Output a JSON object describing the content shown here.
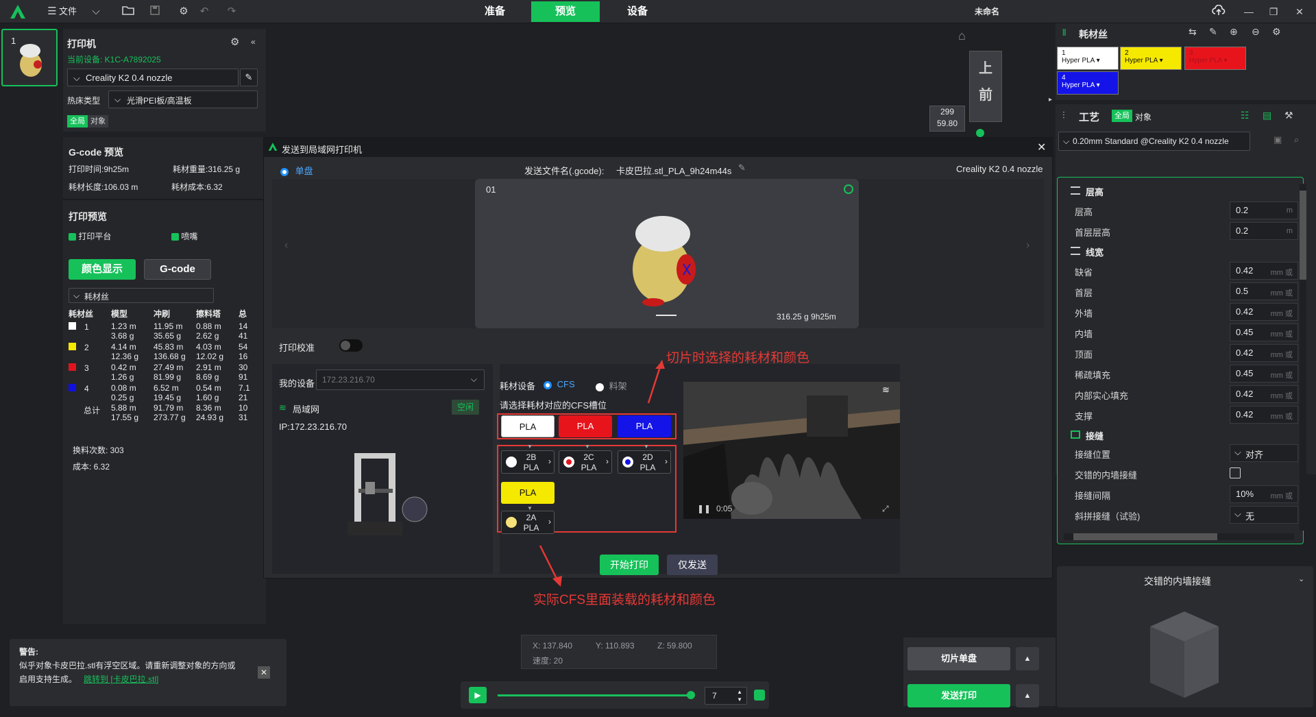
{
  "topbar": {
    "menu_file": "文件",
    "tabs": [
      "准备",
      "预览",
      "设备"
    ],
    "active_tab": "预览",
    "project_name": "未命名"
  },
  "thumb": {
    "index": "1"
  },
  "printer": {
    "title": "打印机",
    "current_device": "当前设备: K1C-A7892025",
    "model": "Creality K2 0.4 nozzle",
    "bed_label": "热床类型",
    "bed_value": "光滑PEI板/高温板",
    "scope_global": "全局",
    "scope_object": "对象"
  },
  "gcode_preview": {
    "title": "G-code 预览",
    "print_time": "打印时间:9h25m",
    "filament_weight": "耗材重量:316.25 g",
    "filament_length": "耗材长度:106.03 m",
    "filament_cost": "耗材成本:6.32"
  },
  "print_preview": {
    "title": "打印预览",
    "platform": "打印平台",
    "nozzle": "喷嘴",
    "btn_color": "颜色显示",
    "btn_gcode": "G-code",
    "dropdown": "耗材丝"
  },
  "filament_table": {
    "headers": [
      "耗材丝",
      "模型",
      "冲刷",
      "擦料塔",
      "总"
    ],
    "rows": [
      {
        "id": "1",
        "color": "#ffffff",
        "model": [
          "1.23 m",
          "3.68 g"
        ],
        "flush": [
          "11.95 m",
          "35.65 g"
        ],
        "tower": [
          "0.88 m",
          "2.62 g"
        ],
        "total": [
          "14",
          "41"
        ]
      },
      {
        "id": "2",
        "color": "#f5e900",
        "model": [
          "4.14 m",
          "12.36 g"
        ],
        "flush": [
          "45.83 m",
          "136.68 g"
        ],
        "tower": [
          "4.03 m",
          "12.02 g"
        ],
        "total": [
          "54",
          "16"
        ]
      },
      {
        "id": "3",
        "color": "#e0141e",
        "model": [
          "0.42 m",
          "1.26 g"
        ],
        "flush": [
          "27.49 m",
          "81.99 g"
        ],
        "tower": [
          "2.91 m",
          "8.69 g"
        ],
        "total": [
          "30",
          "91"
        ]
      },
      {
        "id": "4",
        "color": "#1010e0",
        "model": [
          "0.08 m",
          "0.25 g"
        ],
        "flush": [
          "6.52 m",
          "19.45 g"
        ],
        "tower": [
          "0.54 m",
          "1.60 g"
        ],
        "total": [
          "7.1",
          "21"
        ]
      }
    ],
    "total_label": "总计",
    "total": {
      "model": [
        "5.88 m",
        "17.55 g"
      ],
      "flush": [
        "91.79 m",
        "273.77 g"
      ],
      "tower": [
        "8.36 m",
        "24.93 g"
      ],
      "total": [
        "10",
        "31"
      ]
    },
    "change_count": "换料次数:  303",
    "cost": "成本:  6.32"
  },
  "view": {
    "top_label": "上",
    "front_label": "前",
    "layer_top": "299",
    "layer_height": "59.80"
  },
  "dialog": {
    "title": "发送到局域网打印机",
    "mode": "单盘",
    "filename_label": "发送文件名(.gcode):",
    "filename": "卡皮巴拉.stl_PLA_9h24m44s",
    "printer_model": "Creality K2 0.4 nozzle",
    "plate_no": "01",
    "plate_stats": "316.25 g  9h25m",
    "calibration": "打印校准",
    "my_device": "我的设备",
    "device_ip": "172.23.216.70",
    "lan": "局域网",
    "idle": "空闲",
    "ip": "IP:172.23.216.70",
    "filament_device": "耗材设备",
    "cfs": "CFS",
    "rack": "料架",
    "select_slot": "请选择耗材对应的CFS槽位",
    "selected": [
      {
        "label": "PLA",
        "bg": "#ffffff",
        "fg": "#111111"
      },
      {
        "label": "PLA",
        "bg": "#e8141c",
        "fg": "#ffffff"
      },
      {
        "label": "PLA",
        "bg": "#1414e8",
        "fg": "#ffffff"
      }
    ],
    "slots": [
      {
        "code": "2B",
        "type": "PLA",
        "dot": "#ffffff"
      },
      {
        "code": "2C",
        "type": "PLA",
        "dot": "#e8141c"
      },
      {
        "code": "2D",
        "type": "PLA",
        "dot": "#1414e8"
      }
    ],
    "yellow": {
      "label": "PLA"
    },
    "slot_2a": {
      "code": "2A",
      "type": "PLA",
      "dot": "#f5e07a"
    },
    "cam_time": "0:05",
    "btn_start": "开始打印",
    "btn_send": "仅发送"
  },
  "annotations": {
    "top": "切片时选择的耗材和颜色",
    "bottom": "实际CFS里面装载的耗材和颜色"
  },
  "coords": {
    "x": "X: 137.840",
    "y": "Y: 110.893",
    "z": "Z: 59.800",
    "speed": "速度: 20"
  },
  "playback": {
    "layer": "7"
  },
  "warning": {
    "title": "警告:",
    "line1": "似乎对象卡皮巴拉.stl有浮空区域。请重新调整对象的方向或",
    "line2": "启用支持生成。",
    "link": "跳转到 [卡皮巴拉.stl]"
  },
  "actions": {
    "slice": "切片单盘",
    "send": "发送打印"
  },
  "right": {
    "filament_title": "耗材丝",
    "filaments": [
      {
        "id": "1",
        "name": "Hyper PLA",
        "bg": "#ffffff",
        "fg": "#111111"
      },
      {
        "id": "2",
        "name": "Hyper PLA",
        "bg": "#f5e900",
        "fg": "#111111"
      },
      {
        "id": "3",
        "name": "Hyper PLA",
        "bg": "#e8141c",
        "fg": "#b0101a"
      },
      {
        "id": "4",
        "name": "Hyper PLA",
        "bg": "#1414e8",
        "fg": "#ffffff"
      }
    ],
    "process_title": "工艺",
    "scope_global": "全局",
    "scope_object": "对象",
    "profile": "0.20mm Standard @Creality K2 0.4 nozzle",
    "sec_layer": "层高",
    "layer_height": {
      "label": "层高",
      "value": "0.2",
      "unit": "m"
    },
    "first_layer": {
      "label": "首层层高",
      "value": "0.2",
      "unit": "m"
    },
    "sec_width": "线宽",
    "widths": [
      {
        "label": "缺省",
        "value": "0.42"
      },
      {
        "label": "首层",
        "value": "0.5"
      },
      {
        "label": "外墙",
        "value": "0.42"
      },
      {
        "label": "内墙",
        "value": "0.45"
      },
      {
        "label": "顶面",
        "value": "0.42"
      },
      {
        "label": "稀疏填充",
        "value": "0.45"
      },
      {
        "label": "内部实心填充",
        "value": "0.42"
      },
      {
        "label": "支撑",
        "value": "0.42"
      }
    ],
    "width_unit": "mm 或",
    "sec_seam": "接缝",
    "seam_pos": {
      "label": "接缝位置",
      "value": "对齐"
    },
    "seam_stagger": {
      "label": "交错的内墙接缝"
    },
    "seam_gap": {
      "label": "接缝间隔",
      "value": "10%",
      "unit": "mm 或"
    },
    "seam_scarf": {
      "label": "斜拼接缝（试验)",
      "value": "无"
    },
    "tip_title": "交错的内墙接缝"
  }
}
